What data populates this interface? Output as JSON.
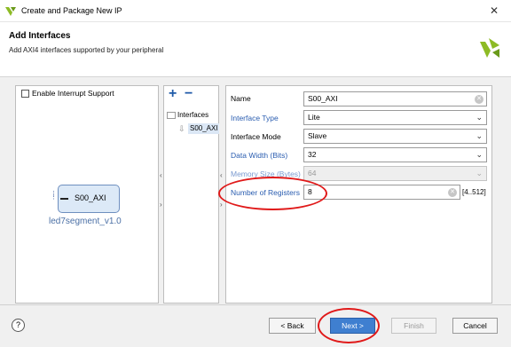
{
  "window": {
    "title": "Create and Package New IP"
  },
  "header": {
    "title": "Add Interfaces",
    "subtitle": "Add AXI4 interfaces supported by your peripheral"
  },
  "left_panel": {
    "checkbox_label": "Enable Interrupt Support",
    "checkbox_checked": false,
    "ip_port_label": "S00_AXI",
    "ip_name": "led7segment_v1.0"
  },
  "interfaces_tree": {
    "add_label": "+",
    "remove_label": "−",
    "root_label": "Interfaces",
    "items": [
      "S00_AXI"
    ]
  },
  "properties": {
    "name": {
      "label": "Name",
      "value": "S00_AXI"
    },
    "interface_type": {
      "label": "Interface Type",
      "value": "Lite"
    },
    "interface_mode": {
      "label": "Interface Mode",
      "value": "Slave"
    },
    "data_width": {
      "label": "Data Width (Bits)",
      "value": "32"
    },
    "memory_size": {
      "label": "Memory Size (Bytes)",
      "value": "64",
      "disabled": true
    },
    "num_registers": {
      "label": "Number of Registers",
      "value": "8",
      "range": "[4..512]"
    }
  },
  "footer": {
    "help_label": "?",
    "back_label": "< Back",
    "next_label": "Next >",
    "finish_label": "Finish",
    "cancel_label": "Cancel"
  },
  "colors": {
    "accent": "#3f7fd0",
    "link_label": "#2a5db0",
    "annotation": "#e01919"
  }
}
